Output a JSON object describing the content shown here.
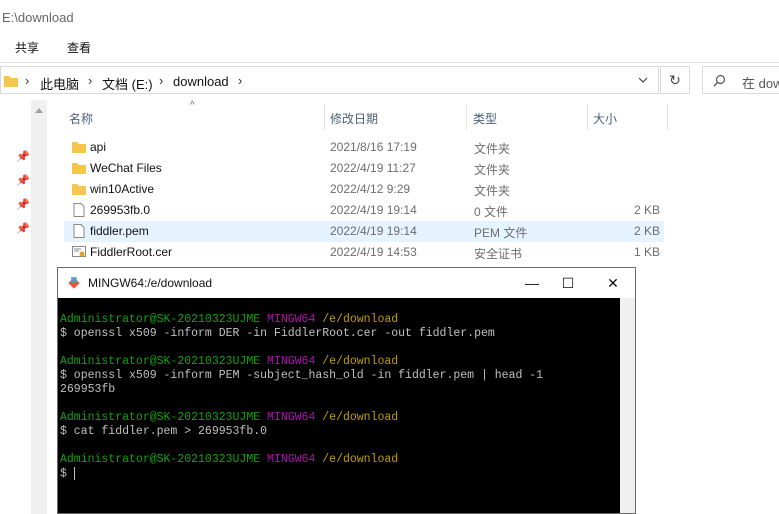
{
  "window": {
    "title": "E:\\download"
  },
  "ribbon": {
    "tabs": [
      "共享",
      "查看"
    ]
  },
  "address": {
    "crumbs": [
      "此电脑",
      "文档 (E:)",
      "download"
    ],
    "search_placeholder": "在 dow"
  },
  "columns": {
    "name": "名称",
    "date": "修改日期",
    "type": "类型",
    "size": "大小"
  },
  "files": [
    {
      "name": "api",
      "date": "2021/8/16 17:19",
      "type": "文件夹",
      "size": "",
      "icon": "folder-icon"
    },
    {
      "name": "WeChat Files",
      "date": "2022/4/19 11:27",
      "type": "文件夹",
      "size": "",
      "icon": "folder-icon"
    },
    {
      "name": "win10Active",
      "date": "2022/4/12 9:29",
      "type": "文件夹",
      "size": "",
      "icon": "folder-icon"
    },
    {
      "name": "269953fb.0",
      "date": "2022/4/19 19:14",
      "type": "0 文件",
      "size": "2 KB",
      "icon": "file-icon"
    },
    {
      "name": "fiddler.pem",
      "date": "2022/4/19 19:14",
      "type": "PEM 文件",
      "size": "2 KB",
      "icon": "file-icon"
    },
    {
      "name": "FiddlerRoot.cer",
      "date": "2022/4/19 14:53",
      "type": "安全证书",
      "size": "1 KB",
      "icon": "certificate-icon"
    }
  ],
  "terminal": {
    "title": "MINGW64:/e/download",
    "prompt_user": "Administrator@SK-20210323UJME",
    "prompt_env": "MINGW64",
    "prompt_path": "/e/download",
    "commands": [
      {
        "cmd": "$ openssl x509 -inform DER -in FiddlerRoot.cer -out fiddler.pem",
        "output": ""
      },
      {
        "cmd": "$ openssl x509 -inform PEM -subject_hash_old -in fiddler.pem | head -1",
        "output": "269953fb"
      },
      {
        "cmd": "$ cat fiddler.pem > 269953fb.0",
        "output": ""
      },
      {
        "cmd": "$ ",
        "output": ""
      }
    ]
  },
  "colors": {
    "selection": "#e5f3ff",
    "folder": "#f4c64c",
    "term_green": "#13a10e",
    "term_magenta": "#b010b0",
    "term_yellow": "#c19c00"
  }
}
